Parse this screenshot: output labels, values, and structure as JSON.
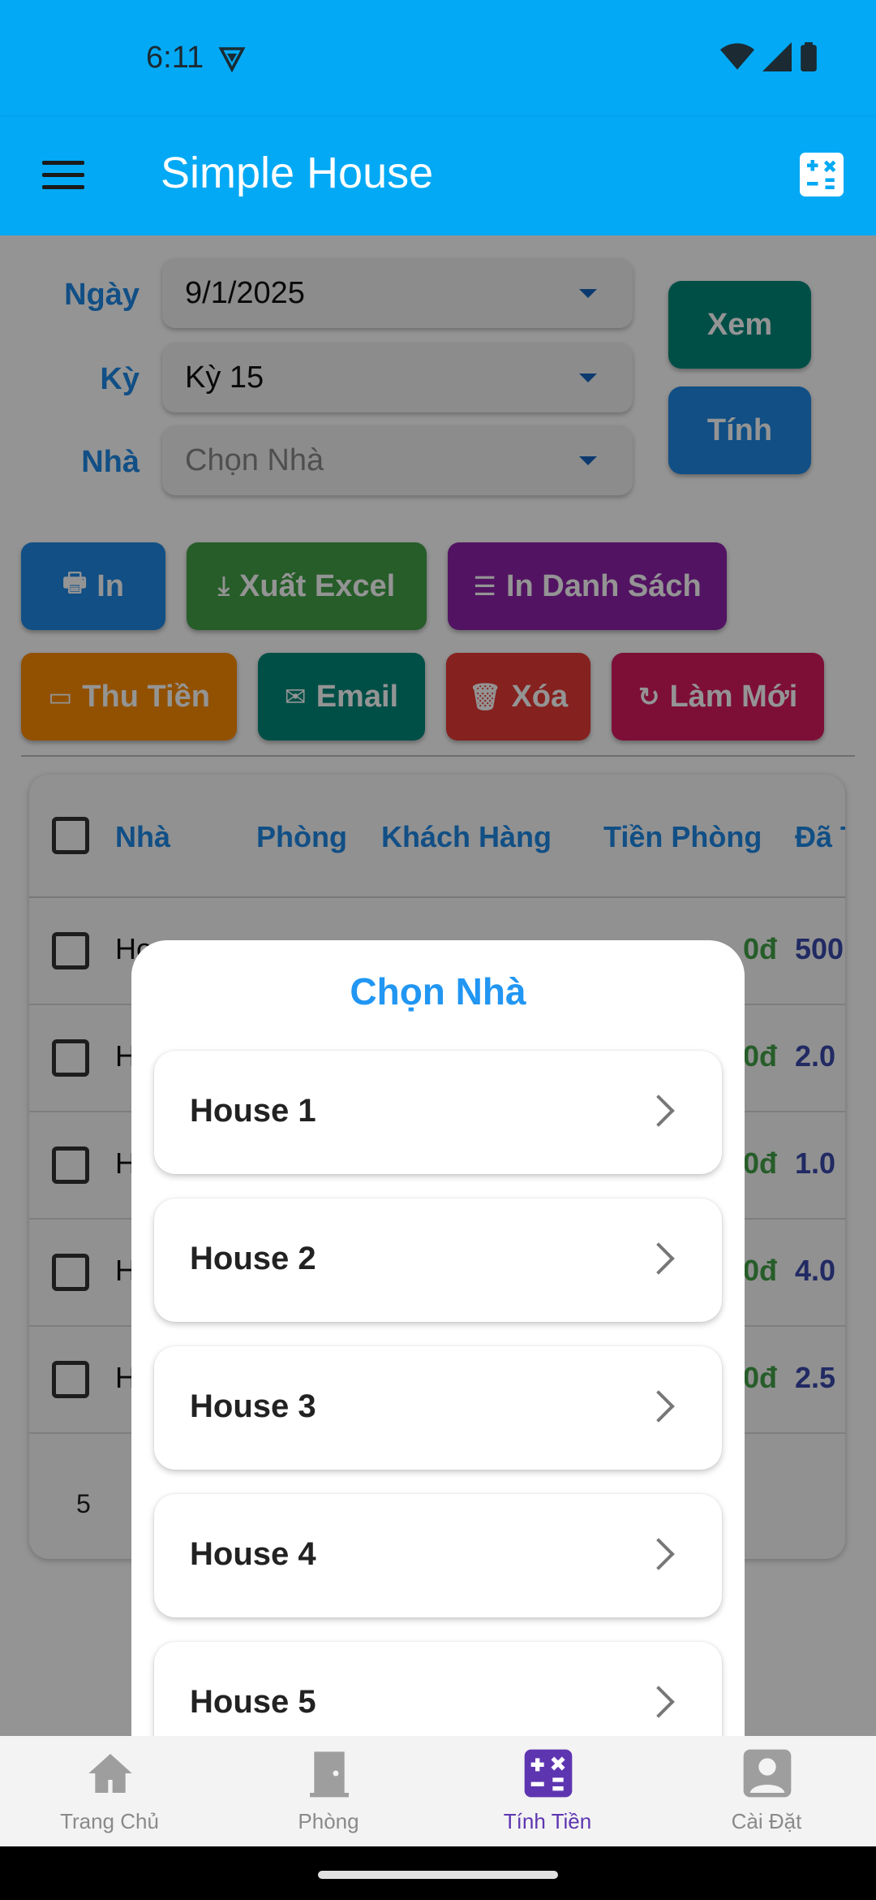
{
  "status": {
    "time": "6:11"
  },
  "app": {
    "title": "Simple House"
  },
  "filters": {
    "date_label": "Ngày",
    "date_value": "9/1/2025",
    "period_label": "Kỳ",
    "period_value": "Kỳ 15",
    "house_label": "Nhà",
    "house_placeholder": "Chọn Nhà",
    "view_button": "Xem",
    "calc_button": "Tính"
  },
  "actions": {
    "print": "In",
    "export_excel": "Xuất Excel",
    "print_list": "In Danh Sách",
    "collect": "Thu Tiền",
    "email": "Email",
    "delete": "Xóa",
    "refresh": "Làm Mới"
  },
  "table": {
    "headers": [
      "Nhà",
      "Phòng",
      "Khách Hàng",
      "Tiền Phòng",
      "Đã T"
    ],
    "rows": [
      {
        "house": "Ho",
        "room_fee": "0đ",
        "paid": "500"
      },
      {
        "house": "H",
        "room_fee": "0đ",
        "paid": "2.0"
      },
      {
        "house": "H",
        "room_fee": "0đ",
        "paid": "1.0"
      },
      {
        "house": "H",
        "room_fee": "0đ",
        "paid": "4.0"
      },
      {
        "house": "H",
        "room_fee": "0đ",
        "paid": "2.5"
      }
    ],
    "rows_per_page": "5"
  },
  "dialog": {
    "title": "Chọn Nhà",
    "houses": [
      "House 1",
      "House 2",
      "House 3",
      "House 4",
      "House 5"
    ]
  },
  "nav": {
    "items": [
      {
        "label": "Trang Chủ",
        "icon": "home-icon"
      },
      {
        "label": "Phòng",
        "icon": "door-icon"
      },
      {
        "label": "Tính Tiền",
        "icon": "calculator-icon"
      },
      {
        "label": "Cài Đặt",
        "icon": "account-icon"
      }
    ],
    "active_index": 2
  },
  "colors": {
    "primary": "#03a9f4",
    "view": "#00897b",
    "calc": "#1e88e5",
    "print": "#1e88e5",
    "excel": "#43a047",
    "print_list": "#8e24aa",
    "collect": "#fb8c00",
    "email": "#00897b",
    "delete": "#e53935",
    "refresh": "#d81b60",
    "nav_active": "#5e35b1"
  }
}
